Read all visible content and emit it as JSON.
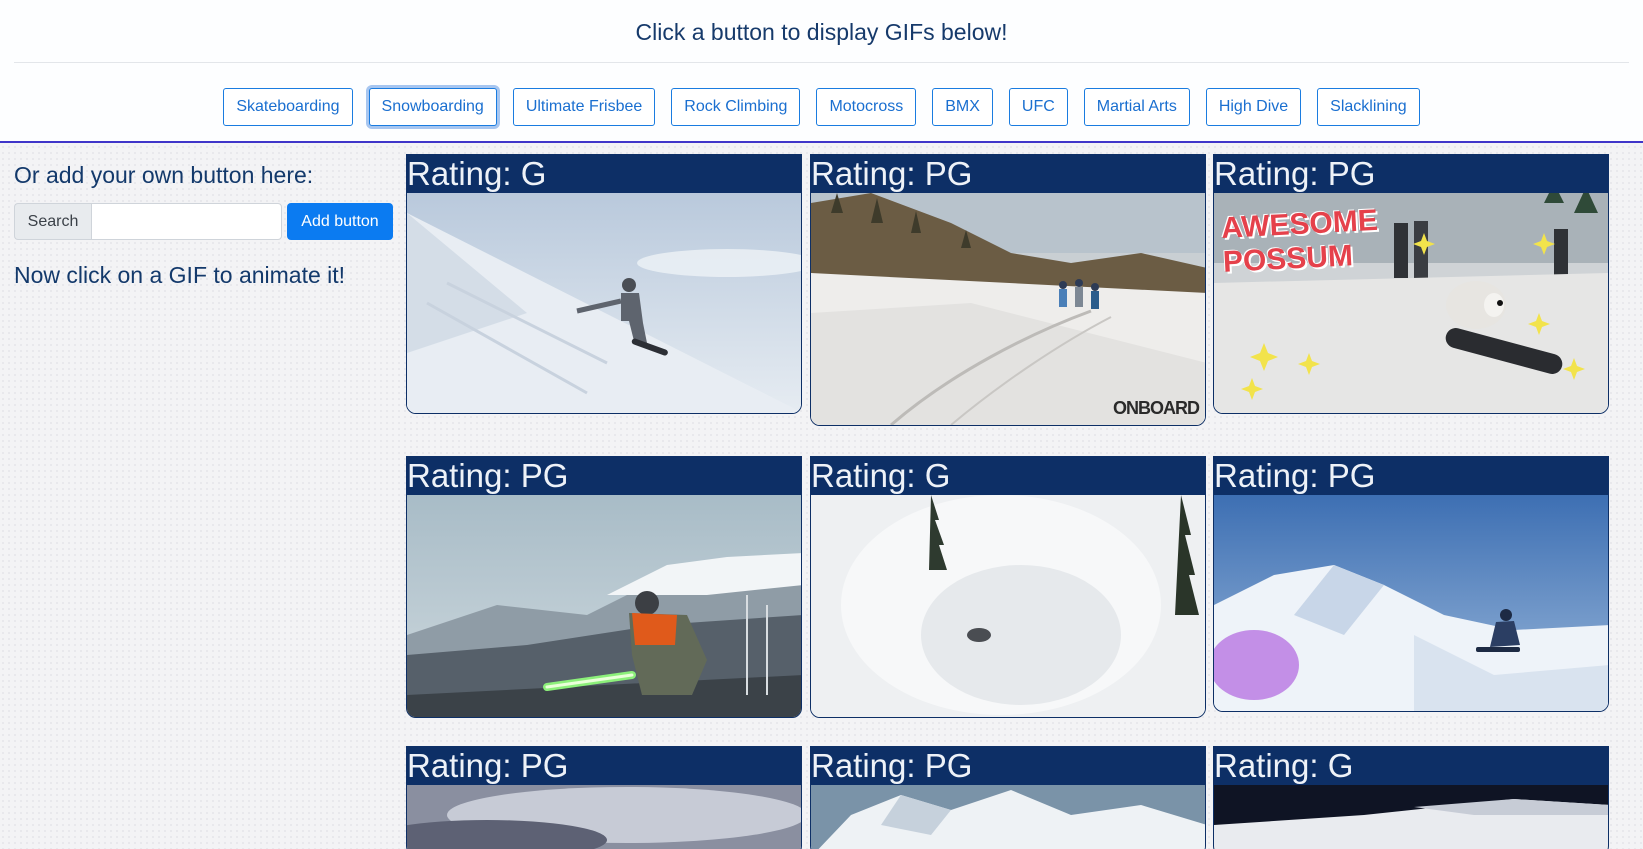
{
  "header": {
    "title": "Click a button to display GIFs below!"
  },
  "topics": [
    {
      "label": "Skateboarding",
      "active": false
    },
    {
      "label": "Snowboarding",
      "active": true
    },
    {
      "label": "Ultimate Frisbee",
      "active": false
    },
    {
      "label": "Rock Climbing",
      "active": false
    },
    {
      "label": "Motocross",
      "active": false
    },
    {
      "label": "BMX",
      "active": false
    },
    {
      "label": "UFC",
      "active": false
    },
    {
      "label": "Martial Arts",
      "active": false
    },
    {
      "label": "High Dive",
      "active": false
    },
    {
      "label": "Slacklining",
      "active": false
    }
  ],
  "sidebar": {
    "heading": "Or add your own button here:",
    "search_label": "Search",
    "search_value": "",
    "add_button": "Add button",
    "instruction": "Now click on a GIF to animate it!"
  },
  "gifs": [
    {
      "rating": "Rating: G",
      "image": "snowboarder-on-steep-slope"
    },
    {
      "rating": "Rating: PG",
      "image": "snowboard-park-run",
      "watermark": "ONBOARD"
    },
    {
      "rating": "Rating: PG",
      "image": "possum-on-snowboard",
      "caption": "AWESOME POSSUM"
    },
    {
      "rating": "Rating: PG",
      "image": "snowboarder-with-lightsaber"
    },
    {
      "rating": "Rating: G",
      "image": "powder-spray"
    },
    {
      "rating": "Rating: PG",
      "image": "snowboarder-on-cornice"
    },
    {
      "rating": "Rating: PG",
      "image": "cloudy-mountain"
    },
    {
      "rating": "Rating: PG",
      "image": "snowy-peaks"
    },
    {
      "rating": "Rating: G",
      "image": "dark-slope"
    }
  ],
  "colors": {
    "accent": "#0b7bf1",
    "rating_bar": "#0d2f66",
    "header_text": "#163a6b",
    "divider": "#3f35c9"
  }
}
